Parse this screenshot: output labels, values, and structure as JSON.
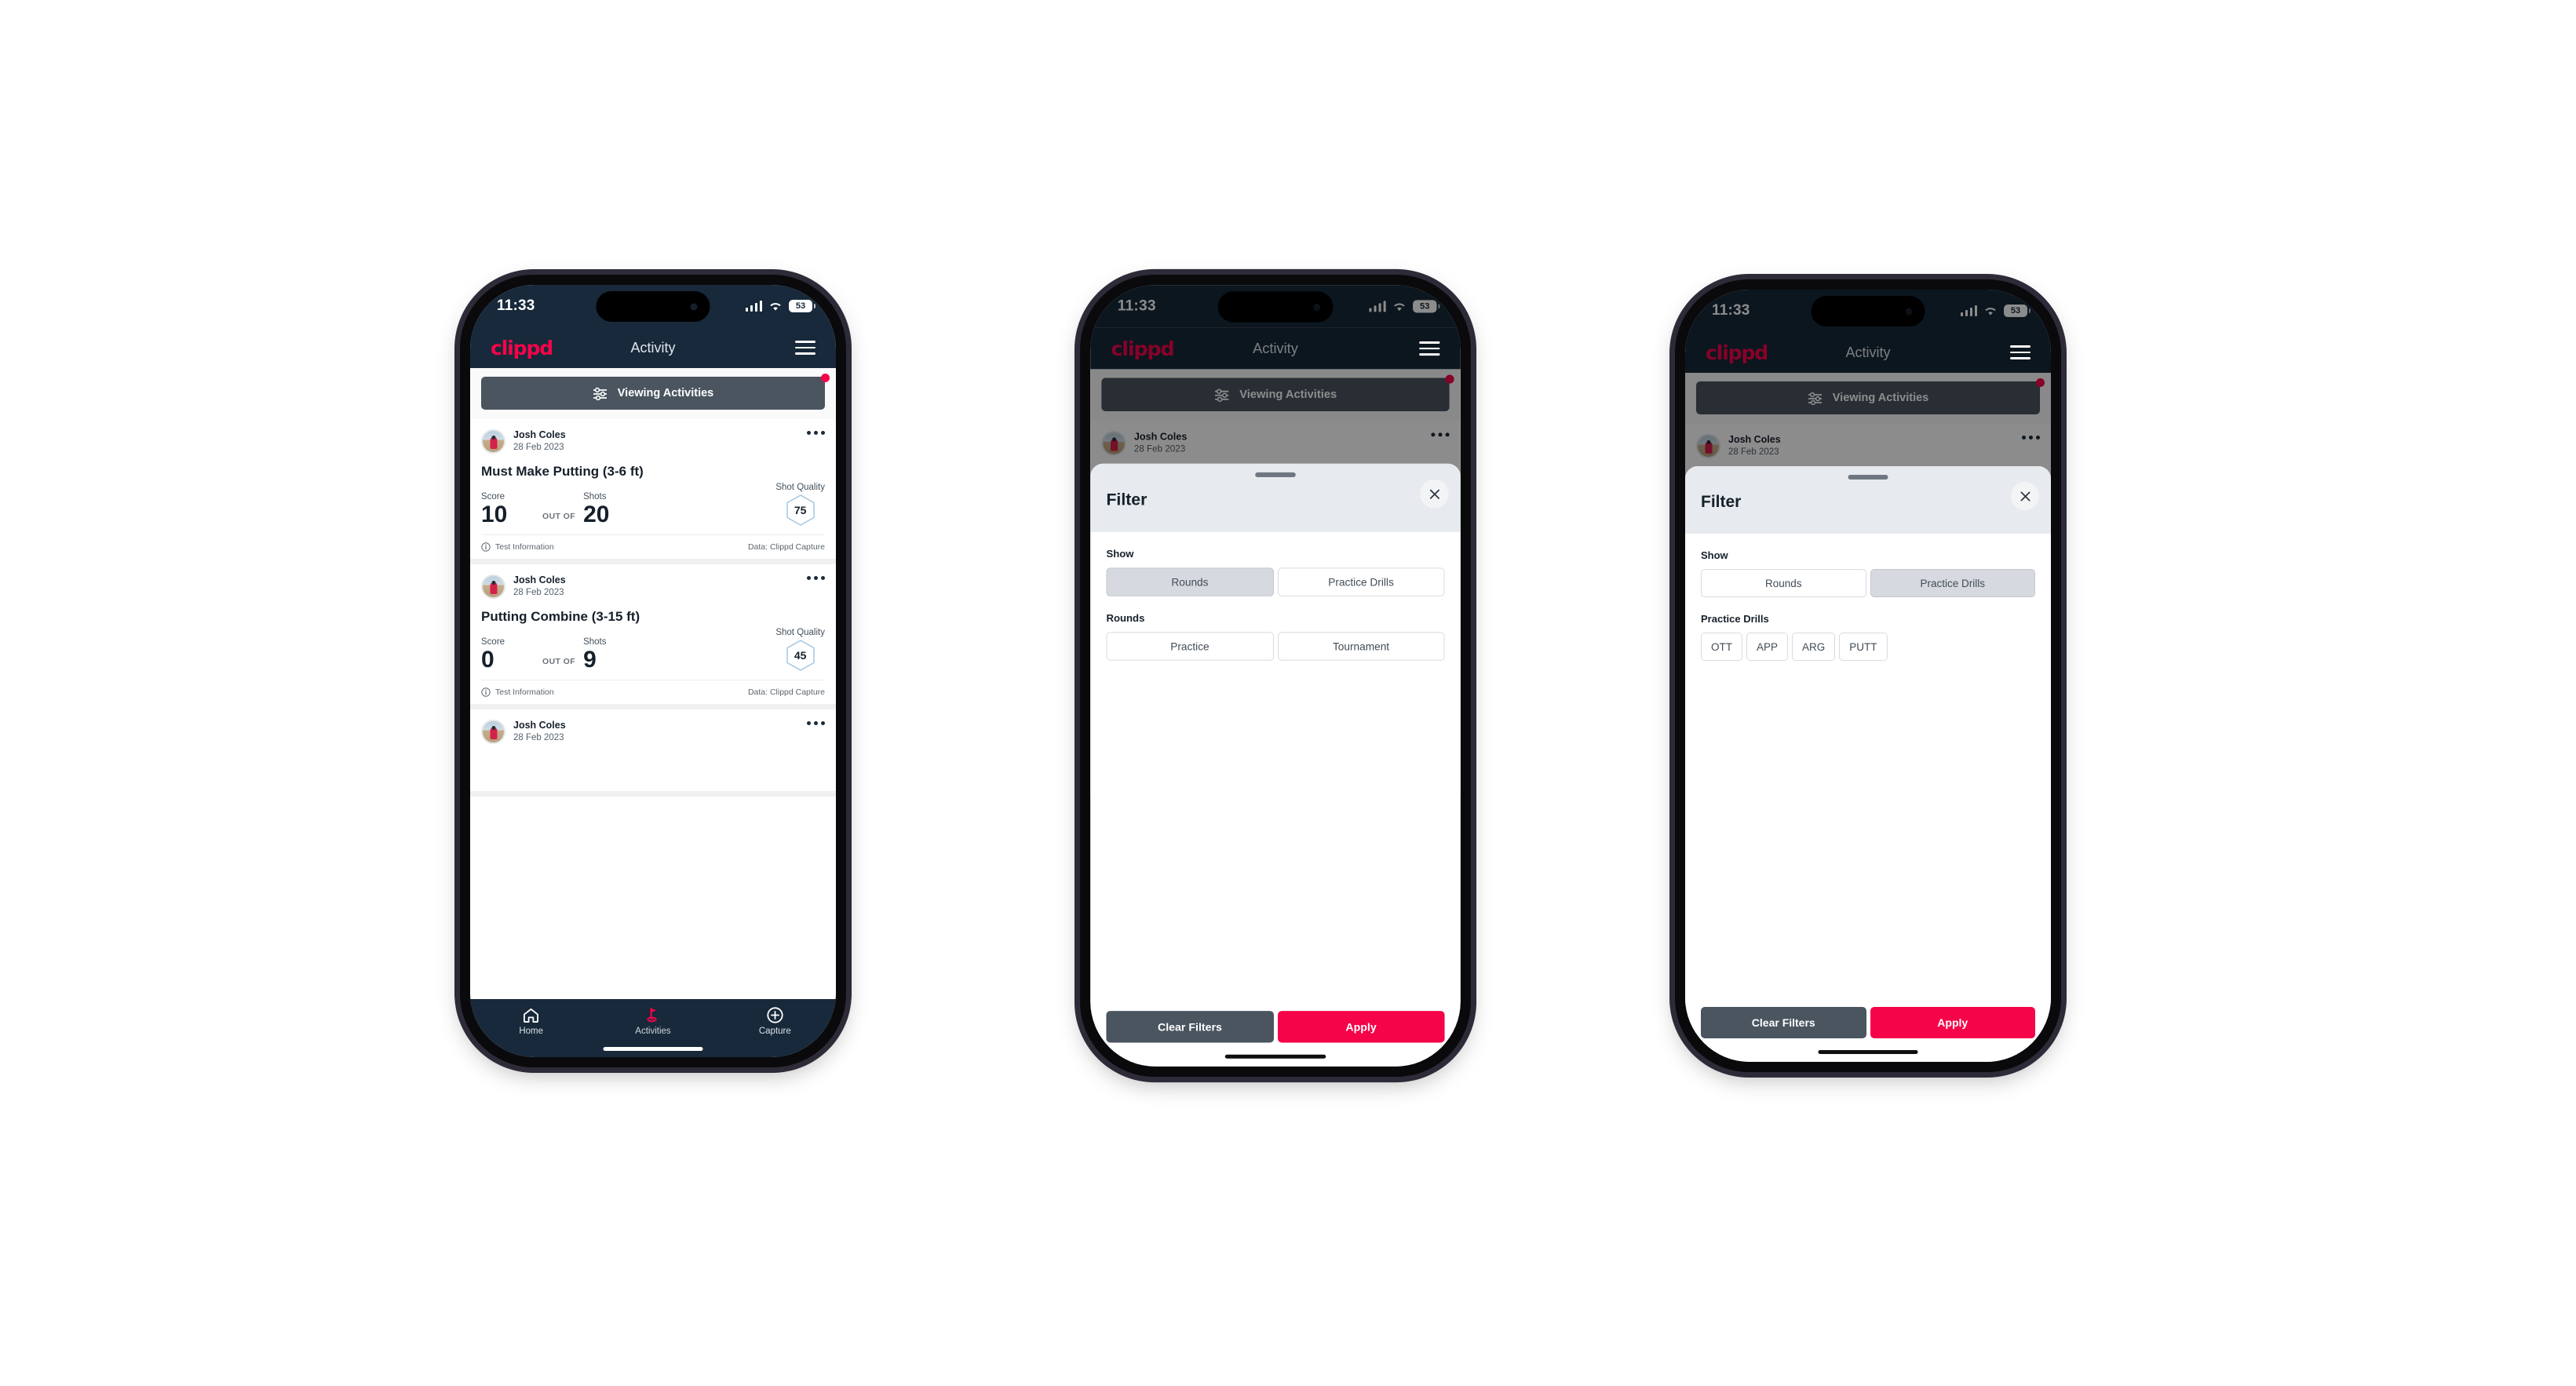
{
  "app": {
    "brand": "clippd",
    "title": "Activity",
    "accent_color": "#f5044a",
    "header_bg": "#17293a",
    "slate": "#4a5560"
  },
  "status_bar": {
    "time": "11:33",
    "battery": "53",
    "signal_icon": "cellular-bars-icon",
    "wifi_icon": "wifi-icon",
    "battery_icon": "battery-icon"
  },
  "filter_bar": {
    "label": "Viewing Activities",
    "icon": "sliders-icon",
    "has_badge": true
  },
  "activities": [
    {
      "user": "Josh Coles",
      "date": "28 Feb 2023",
      "title": "Must Make Putting (3-6 ft)",
      "score_label": "Score",
      "score_value": "10",
      "out_of": "OUT OF",
      "shots_label": "Shots",
      "shots_value": "20",
      "quality_label": "Shot Quality",
      "quality_value": "75",
      "footer_left": "Test Information",
      "footer_right": "Data: Clippd Capture"
    },
    {
      "user": "Josh Coles",
      "date": "28 Feb 2023",
      "title": "Putting Combine (3-15 ft)",
      "score_label": "Score",
      "score_value": "0",
      "out_of": "OUT OF",
      "shots_label": "Shots",
      "shots_value": "9",
      "quality_label": "Shot Quality",
      "quality_value": "45",
      "footer_left": "Test Information",
      "footer_right": "Data: Clippd Capture"
    },
    {
      "user": "Josh Coles",
      "date": "28 Feb 2023"
    }
  ],
  "tabs": [
    {
      "label": "Home",
      "icon": "home-icon",
      "active": false
    },
    {
      "label": "Activities",
      "icon": "golf-flag-icon",
      "active": true
    },
    {
      "label": "Capture",
      "icon": "plus-circle-icon",
      "active": false
    }
  ],
  "filter_modal": {
    "title": "Filter",
    "close_icon": "close-icon",
    "show_label": "Show",
    "show_options": [
      "Rounds",
      "Practice Drills"
    ],
    "rounds_label": "Rounds",
    "rounds_options": [
      "Practice",
      "Tournament"
    ],
    "drills_label": "Practice Drills",
    "drills_options": [
      "OTT",
      "APP",
      "ARG",
      "PUTT"
    ],
    "clear_label": "Clear Filters",
    "apply_label": "Apply",
    "state_rounds_selected": "Rounds",
    "state_drills_selected": "Practice Drills"
  }
}
